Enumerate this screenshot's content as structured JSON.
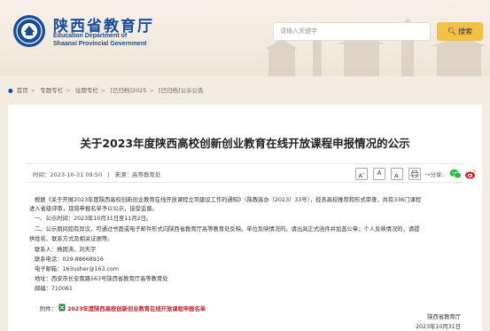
{
  "header": {
    "site_name_cn": "陕西省教育厅",
    "site_name_en_line1": "Education Department of",
    "site_name_en_line2": "Shaanxi Provincial Government",
    "search_placeholder": "请输入关键字",
    "search_button_label": "搜索",
    "accent_color": "#1a4c9c",
    "search_button_color": "#f3c146"
  },
  "breadcrumb": {
    "items": [
      "首页",
      "专题专栏",
      "往期专栏",
      "[已归档]2025",
      "[已归档]公示公告"
    ]
  },
  "article": {
    "title": "关于2023年度陕西高校创新创业教育在线开放课程申报情况的公示",
    "time_label": "时间：",
    "time_value": "2023-10-31 09:50",
    "source_label": "来源：",
    "source_value": "高等教育处",
    "font_sizes": [
      "A",
      "A",
      "A"
    ],
    "share_label": "分享:",
    "paragraphs": {
      "p1_line1": "根据《关于开展2023年度陕西高校创新创业教育在线开放课程立项建设工作的通知》（陕教高办〔2023〕33号），经各高校推荐和形式审查，共有336门课程",
      "p1_line2": "进入省级评审，现将申报名单予以公示，接受监督。",
      "p2": "一、公示时间：2023年10月31日至11月2日。",
      "p3_line1": "二、公示期间如有异议，可通过书面或电子邮件形式向陕西省教育厅高等教育处反映。单位反映情况的，请出具正式函件并加盖公章；个人反映情况的，请提",
      "p3_line2": "供姓名、联系方式及相关证据等。",
      "contact_person": "联系人：杨国涛、刘天宇",
      "contact_phone": "联系电话：029-88668916",
      "contact_email": "电子邮箱：163usher@163.com",
      "contact_address": "地址：西安市长安南路563号陕西省教育厅高等教育处",
      "contact_postcode": "邮编：710061"
    },
    "attachment_label": "附件：",
    "attachment_link": "2023年度陕西高校创新创业教育在线开放课程申报名单",
    "signature": "陕西省教育厅",
    "signature_date": "2023年10月31日"
  }
}
